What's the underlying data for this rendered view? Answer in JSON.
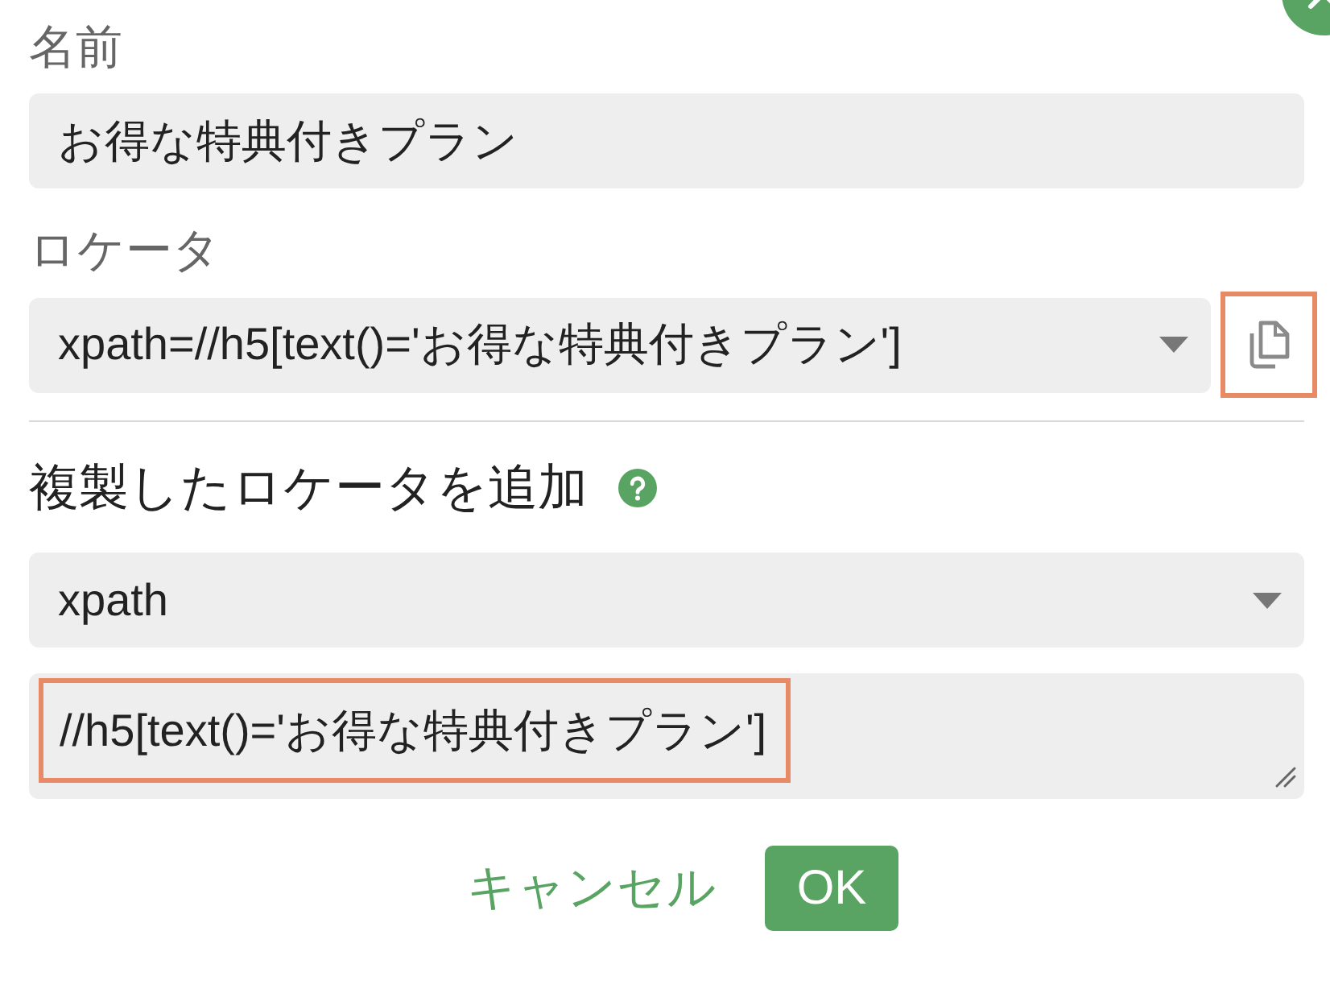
{
  "fields": [
    {
      "kind": "text",
      "label": "名前",
      "value": "お得な特典付きプラン"
    },
    {
      "kind": "select",
      "label": "ロケータ",
      "value": "xpath=//h5[text()='お得な特典付きプラン']",
      "copy_button": {
        "highlighted": true
      }
    }
  ],
  "add_duplicate": {
    "title": "複製したロケータを追加",
    "locator_type": {
      "value": "xpath"
    },
    "locator": {
      "value": "//h5[text()='お得な特典付きプラン']",
      "highlighted": true
    }
  },
  "buttons": [
    {
      "kind": "link",
      "label": "キャンセル"
    },
    {
      "kind": "primary",
      "label": "OK"
    }
  ]
}
